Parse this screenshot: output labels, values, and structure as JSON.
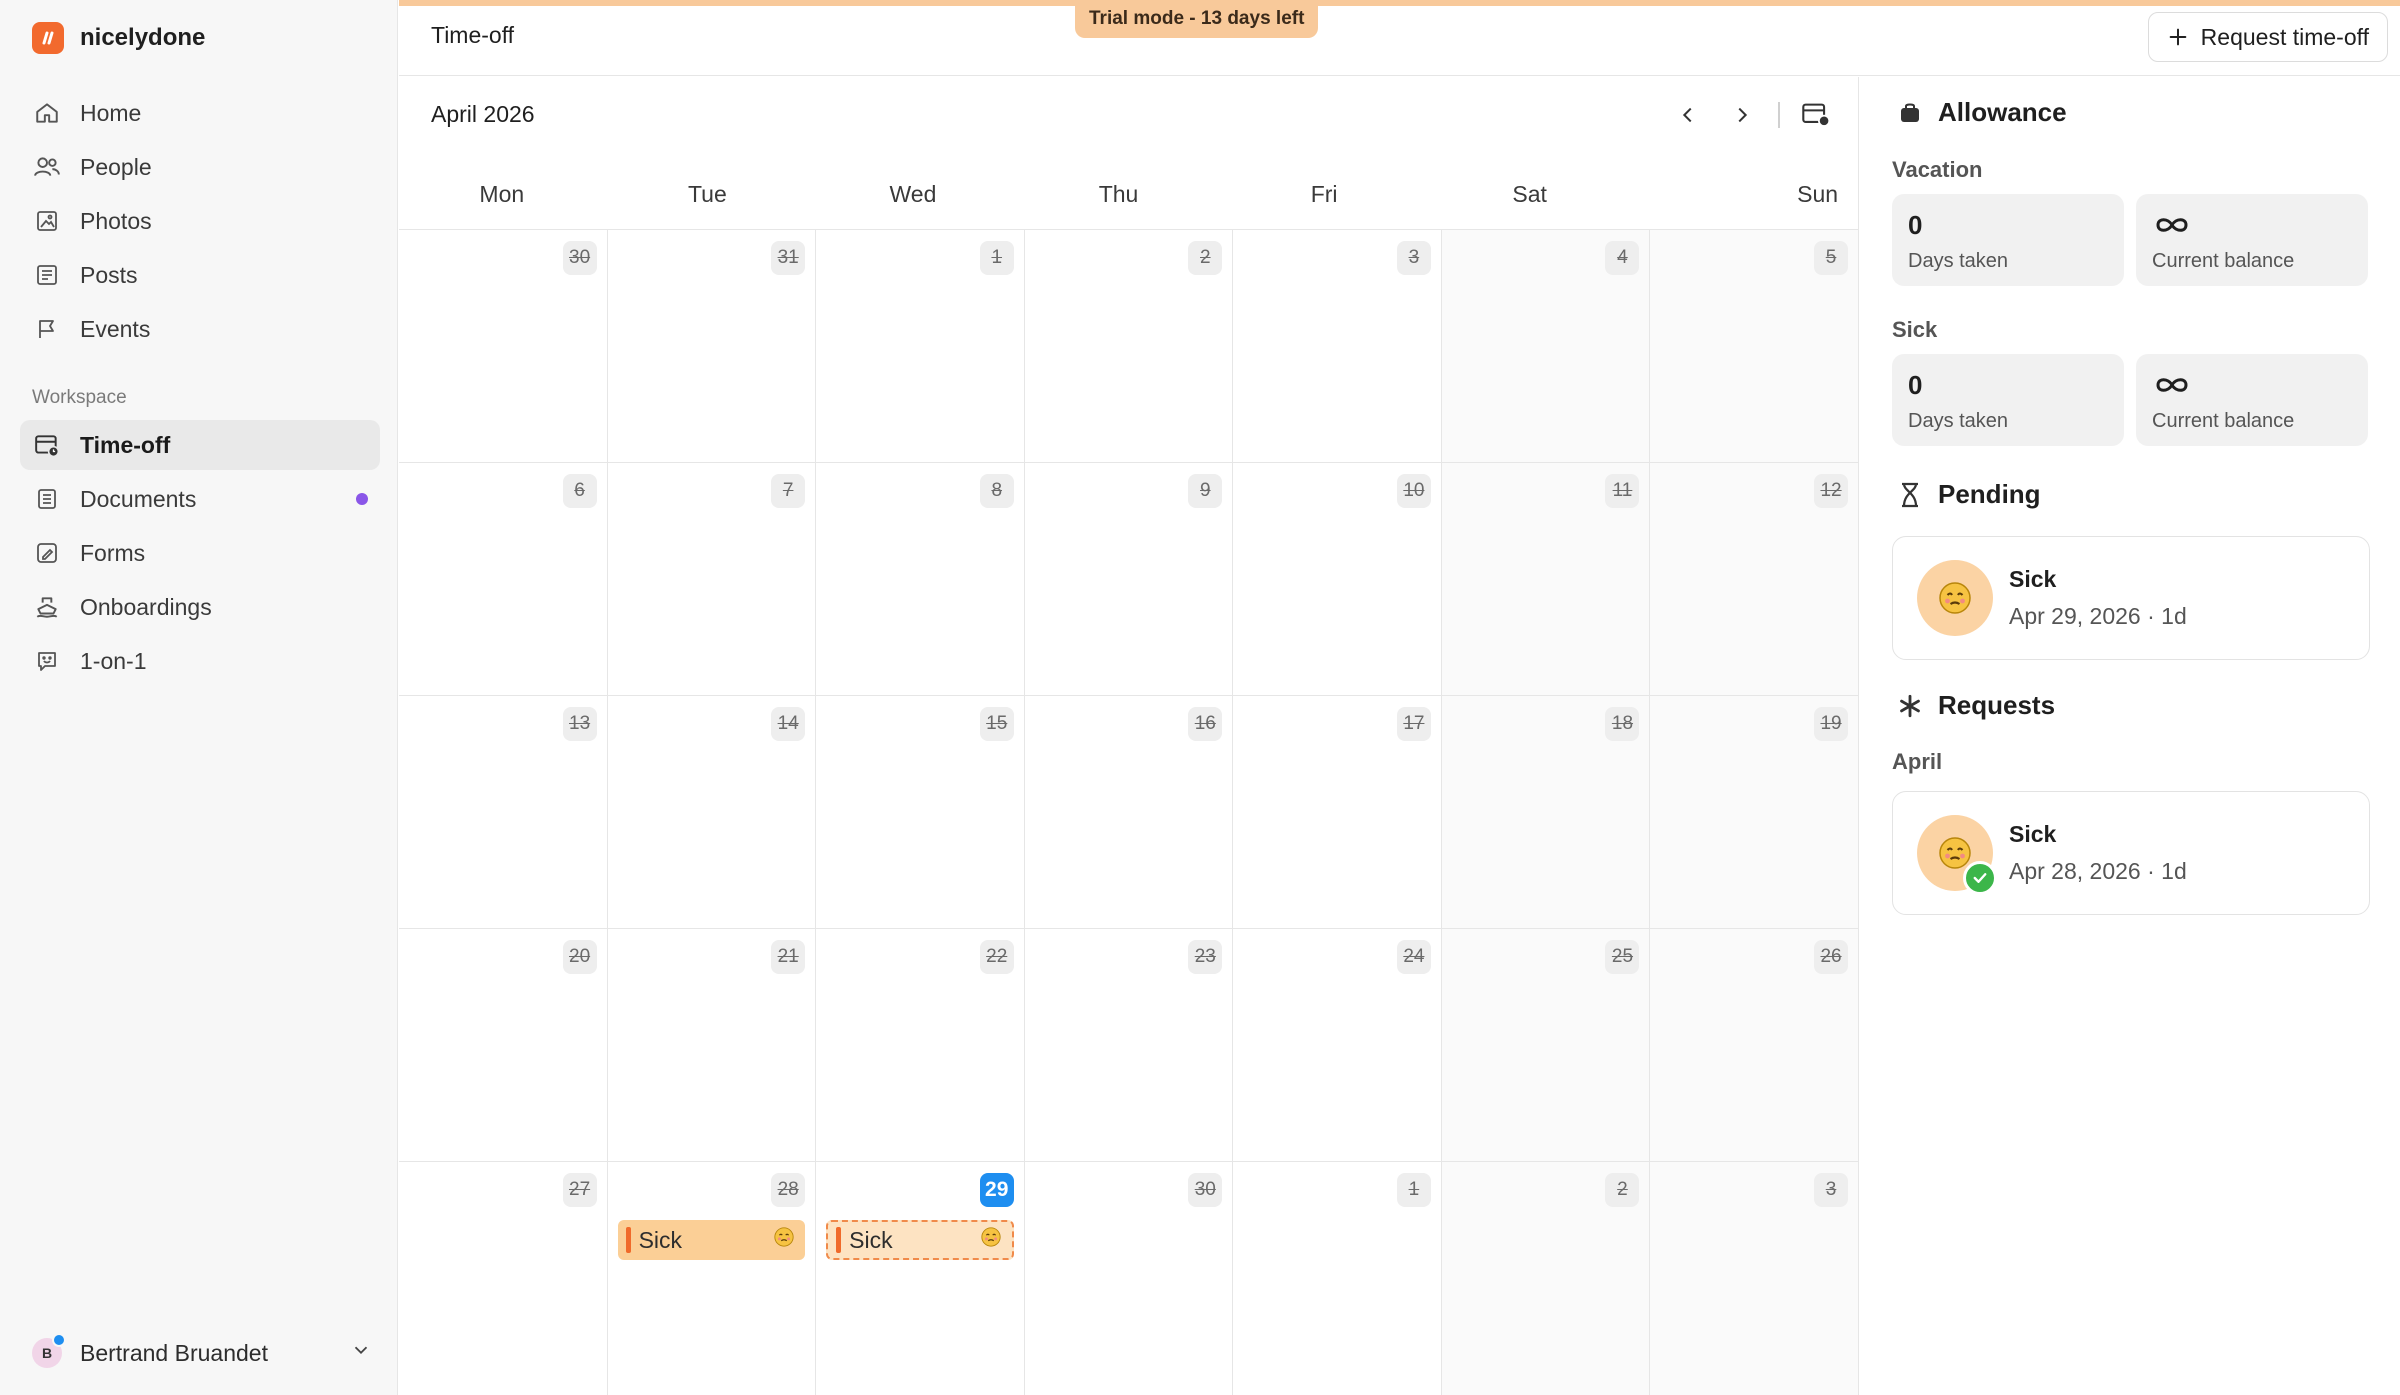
{
  "brand": {
    "name": "nicelydone",
    "accent": "#f26a2e"
  },
  "sidebar": {
    "items": [
      {
        "label": "Home",
        "icon": "home-icon"
      },
      {
        "label": "People",
        "icon": "people-icon"
      },
      {
        "label": "Photos",
        "icon": "photo-icon"
      },
      {
        "label": "Posts",
        "icon": "posts-icon"
      },
      {
        "label": "Events",
        "icon": "flag-icon"
      }
    ],
    "section_label": "Workspace",
    "workspace_items": [
      {
        "label": "Time-off",
        "icon": "calendar-clock-icon",
        "active": true
      },
      {
        "label": "Documents",
        "icon": "document-icon",
        "has_dot": true
      },
      {
        "label": "Forms",
        "icon": "form-icon"
      },
      {
        "label": "Onboardings",
        "icon": "ship-icon"
      },
      {
        "label": "1-on-1",
        "icon": "chat-smile-icon"
      }
    ],
    "user": {
      "name": "Bertrand Bruandet",
      "initial": "B"
    }
  },
  "topbar": {
    "title": "Time-off",
    "trial_badge": "Trial mode - 13 days left",
    "request_button": "Request time-off"
  },
  "calendar": {
    "month_label": "April 2026",
    "weekdays": [
      "Mon",
      "Tue",
      "Wed",
      "Thu",
      "Fri",
      "Sat",
      "Sun"
    ],
    "weeks": [
      [
        "30",
        "31",
        "1",
        "2",
        "3",
        "4",
        "5"
      ],
      [
        "6",
        "7",
        "8",
        "9",
        "10",
        "11",
        "12"
      ],
      [
        "13",
        "14",
        "15",
        "16",
        "17",
        "18",
        "19"
      ],
      [
        "20",
        "21",
        "22",
        "23",
        "24",
        "25",
        "26"
      ],
      [
        "27",
        "28",
        "29",
        "30",
        "1",
        "2",
        "3"
      ]
    ],
    "today": "29",
    "events": [
      {
        "label": "Sick",
        "status": "approved"
      },
      {
        "label": "Sick",
        "status": "pending"
      }
    ],
    "today_color": "#1e8ef0"
  },
  "panel": {
    "allowance_title": "Allowance",
    "vacation": {
      "label": "Vacation",
      "taken_value": "0",
      "taken_label": "Days taken",
      "balance_label": "Current balance"
    },
    "sick": {
      "label": "Sick",
      "taken_value": "0",
      "taken_label": "Days taken",
      "balance_label": "Current balance"
    },
    "pending_title": "Pending",
    "pending_card": {
      "title": "Sick",
      "meta": "Apr 29, 2026 · 1d"
    },
    "requests_title": "Requests",
    "requests_month": "April",
    "request_card": {
      "title": "Sick",
      "meta": "Apr 28, 2026 · 1d"
    }
  }
}
